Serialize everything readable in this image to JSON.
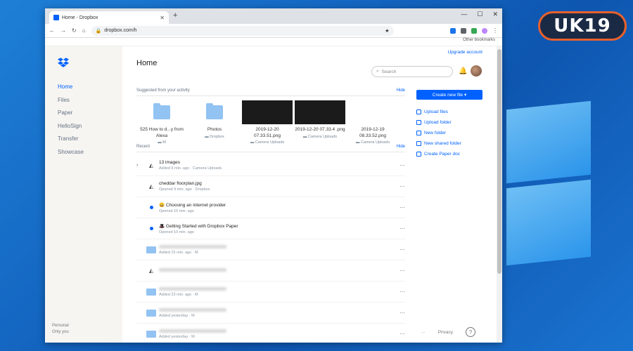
{
  "badge": {
    "text": "UK19"
  },
  "browser": {
    "tab_title": "Home - Dropbox",
    "url": "dropbox.com/h",
    "other_bookmarks": "Other bookmarks"
  },
  "sidebar": {
    "items": [
      {
        "label": "Home",
        "active": true
      },
      {
        "label": "Files"
      },
      {
        "label": "Paper"
      },
      {
        "label": "HelloSign"
      },
      {
        "label": "Transfer"
      },
      {
        "label": "Showcase"
      }
    ],
    "account_line1": "Personal",
    "account_line2": "Only you"
  },
  "main": {
    "title": "Home",
    "upgrade": "Upgrade account",
    "search_placeholder": "Search",
    "suggested_header": "Suggested from your activity",
    "hide": "Hide",
    "recent_header": "Recent",
    "recent_hide": "Hide",
    "cards": [
      {
        "name": "525 How to d...y from Alexa",
        "sub": "M",
        "thumb": "folder"
      },
      {
        "name": "Photos",
        "sub": "Dropbox",
        "thumb": "folder"
      },
      {
        "name": "2019-12-20 07.33.51.png",
        "sub": "Camera Uploads",
        "thumb": "dark"
      },
      {
        "name": "2019-12-20 07.33.4 .png",
        "sub": "Camera Uploads",
        "thumb": "dark"
      },
      {
        "name": "2019-12-19 08.33.52.png",
        "sub": "Camera Uploads",
        "thumb": "none"
      }
    ],
    "rows": [
      {
        "name": "13 images",
        "sub": "Added 9 min. ago · Camera Uploads",
        "icon": "img",
        "chev": true
      },
      {
        "name": "cheddar floorplan.jpg",
        "sub": "Opened 9 min. ago · Dropbox",
        "icon": "img"
      },
      {
        "name": "😀 Choosing an internet provider",
        "sub": "Opened 10 min. ago",
        "icon": "dot"
      },
      {
        "name": "🎩 Getting Started with Dropbox Paper",
        "sub": "Opened 10 min. ago",
        "icon": "dot"
      },
      {
        "sub": "Added 15 min. ago · M",
        "icon": "folder",
        "blur": true
      },
      {
        "sub": "",
        "icon": "img",
        "blur": true
      },
      {
        "sub": "Added 23 min. ago · M",
        "icon": "folder",
        "blur": true
      },
      {
        "sub": "Added yesterday · M",
        "icon": "folder",
        "blur": true
      },
      {
        "sub": "Added yesterday · M",
        "icon": "folder",
        "blur": true
      }
    ]
  },
  "right": {
    "create": "Create new file ▾",
    "items": [
      "Upload files",
      "Upload folder",
      "New folder",
      "New shared folder",
      "Create Paper doc"
    ]
  },
  "footer": {
    "dots": "···",
    "privacy": "Privacy",
    "help": "?"
  }
}
